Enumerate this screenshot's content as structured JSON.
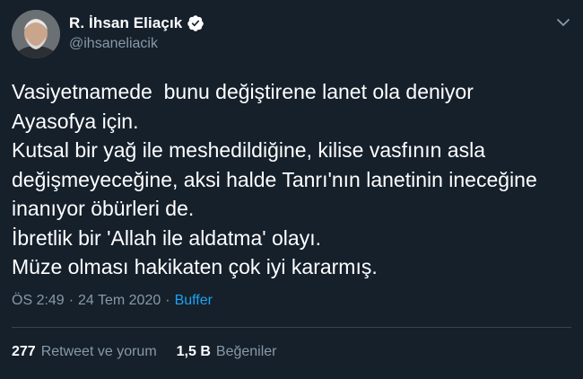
{
  "author": {
    "display_name": "R. İhsan Eliaçık",
    "handle": "@ihsaneliacik",
    "verified": true
  },
  "tweet": {
    "text": "Vasiyetnamede  bunu değiştirene lanet ola deniyor\nAyasofya için.\nKutsal bir yağ ile meshedildiğine, kilise vasfının asla\ndeğişmeyeceğine, aksi halde Tanrı'nın lanetinin ineceğine\ninanıyor öbürleri de.\nİbretlik bir 'Allah ile aldatma' olayı.\nMüze olması hakikaten çok iyi kararmış.",
    "time": "ÖS 2:49",
    "separator": "·",
    "date": "24 Tem 2020",
    "source": "Buffer"
  },
  "stats": {
    "retweets_count": "277",
    "retweets_label": "Retweet ve yorum",
    "likes_count": "1,5 B",
    "likes_label": "Beğeniler"
  },
  "colors": {
    "background": "#15202b",
    "text": "#ffffff",
    "muted": "#8899a6",
    "accent": "#1da1f2",
    "divider": "#38444d"
  },
  "icons": {
    "verified": "verified-badge-icon",
    "caret": "chevron-down-icon"
  }
}
